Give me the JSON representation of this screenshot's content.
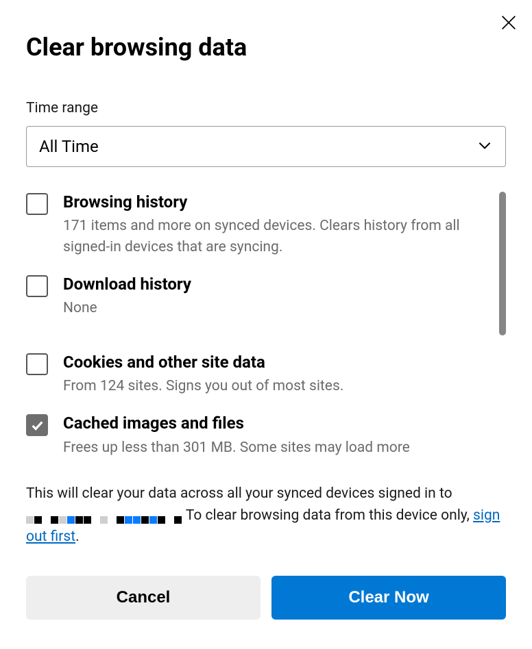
{
  "dialog": {
    "title": "Clear browsing data",
    "timerange_label": "Time range",
    "timerange_value": "All Time"
  },
  "options": [
    {
      "title": "Browsing history",
      "desc": "171 items and more on synced devices. Clears history from all signed-in devices that are syncing.",
      "checked": false
    },
    {
      "title": "Download history",
      "desc": "None",
      "checked": false
    },
    {
      "title": "Cookies and other site data",
      "desc": "From 124 sites. Signs you out of most sites.",
      "checked": false
    },
    {
      "title": "Cached images and files",
      "desc": "Frees up less than 301 MB. Some sites may load more",
      "checked": true
    }
  ],
  "footer": {
    "text_before": "This will clear your data across all your synced devices signed in to ",
    "text_after": " To clear browsing data from this device only, ",
    "link_text": "sign out first",
    "period": "."
  },
  "buttons": {
    "cancel": "Cancel",
    "clear": "Clear Now"
  }
}
